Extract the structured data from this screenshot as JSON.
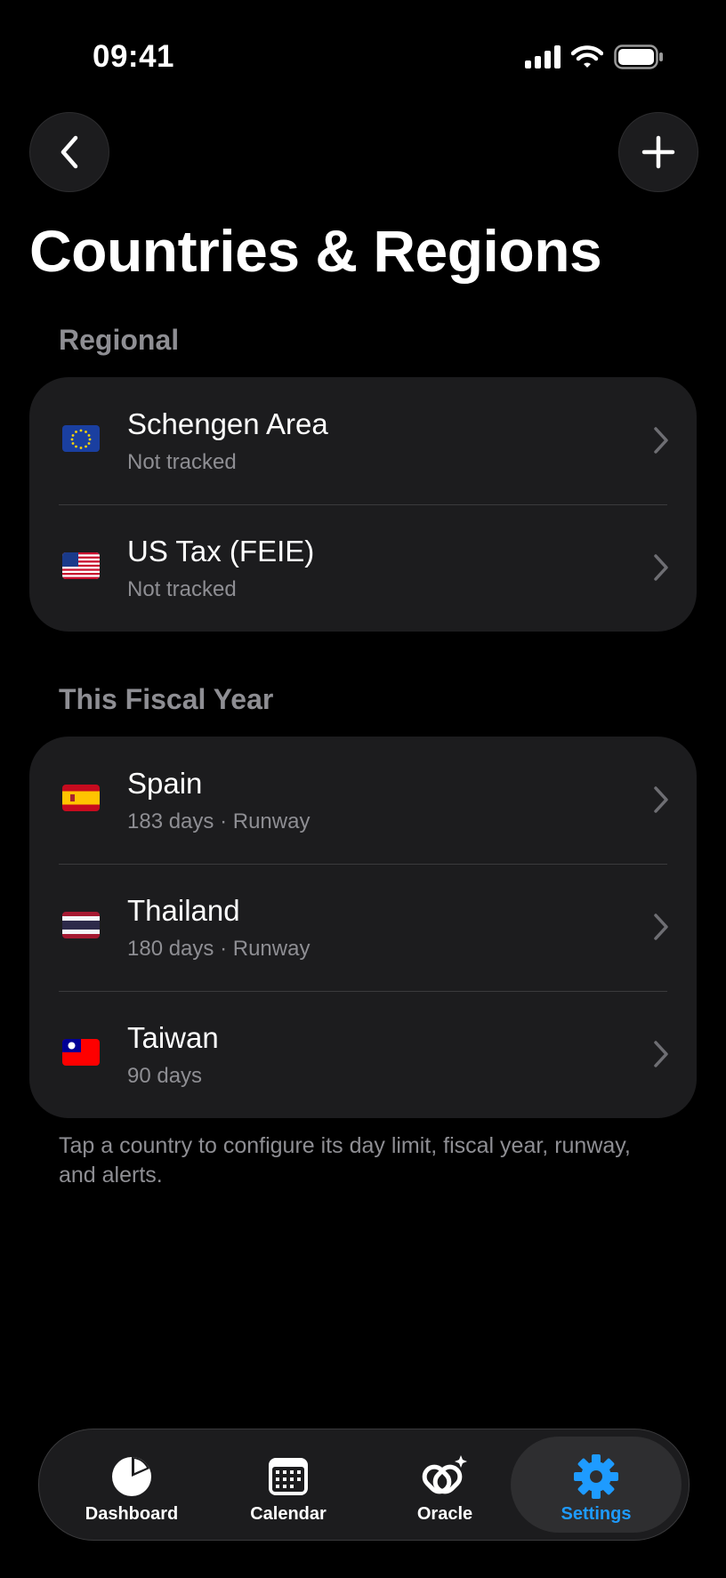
{
  "status_bar": {
    "time": "09:41"
  },
  "page": {
    "title": "Countries & Regions"
  },
  "regional": {
    "header": "Regional",
    "items": [
      {
        "name": "Schengen Area",
        "subtitle": "Not tracked",
        "flag": "eu-flag"
      },
      {
        "name": "US Tax (FEIE)",
        "subtitle": "Not tracked",
        "flag": "us-flag"
      }
    ]
  },
  "fiscal_year": {
    "header": "This Fiscal Year",
    "items": [
      {
        "name": "Spain",
        "subtitle": "183 days · Runway",
        "flag": "spain-flag"
      },
      {
        "name": "Thailand",
        "subtitle": "180 days · Runway",
        "flag": "thailand-flag"
      },
      {
        "name": "Taiwan",
        "subtitle": "90 days",
        "flag": "taiwan-flag"
      }
    ]
  },
  "footnote": "Tap a country to configure its day limit, fiscal year, runway, and alerts.",
  "tab_bar": {
    "tabs": [
      {
        "label": "Dashboard",
        "icon": "pie-chart-icon"
      },
      {
        "label": "Calendar",
        "icon": "calendar-icon"
      },
      {
        "label": "Oracle",
        "icon": "oracle-icon"
      },
      {
        "label": "Settings",
        "icon": "gear-icon",
        "active": true
      }
    ],
    "active_color": "#1e9bff"
  }
}
